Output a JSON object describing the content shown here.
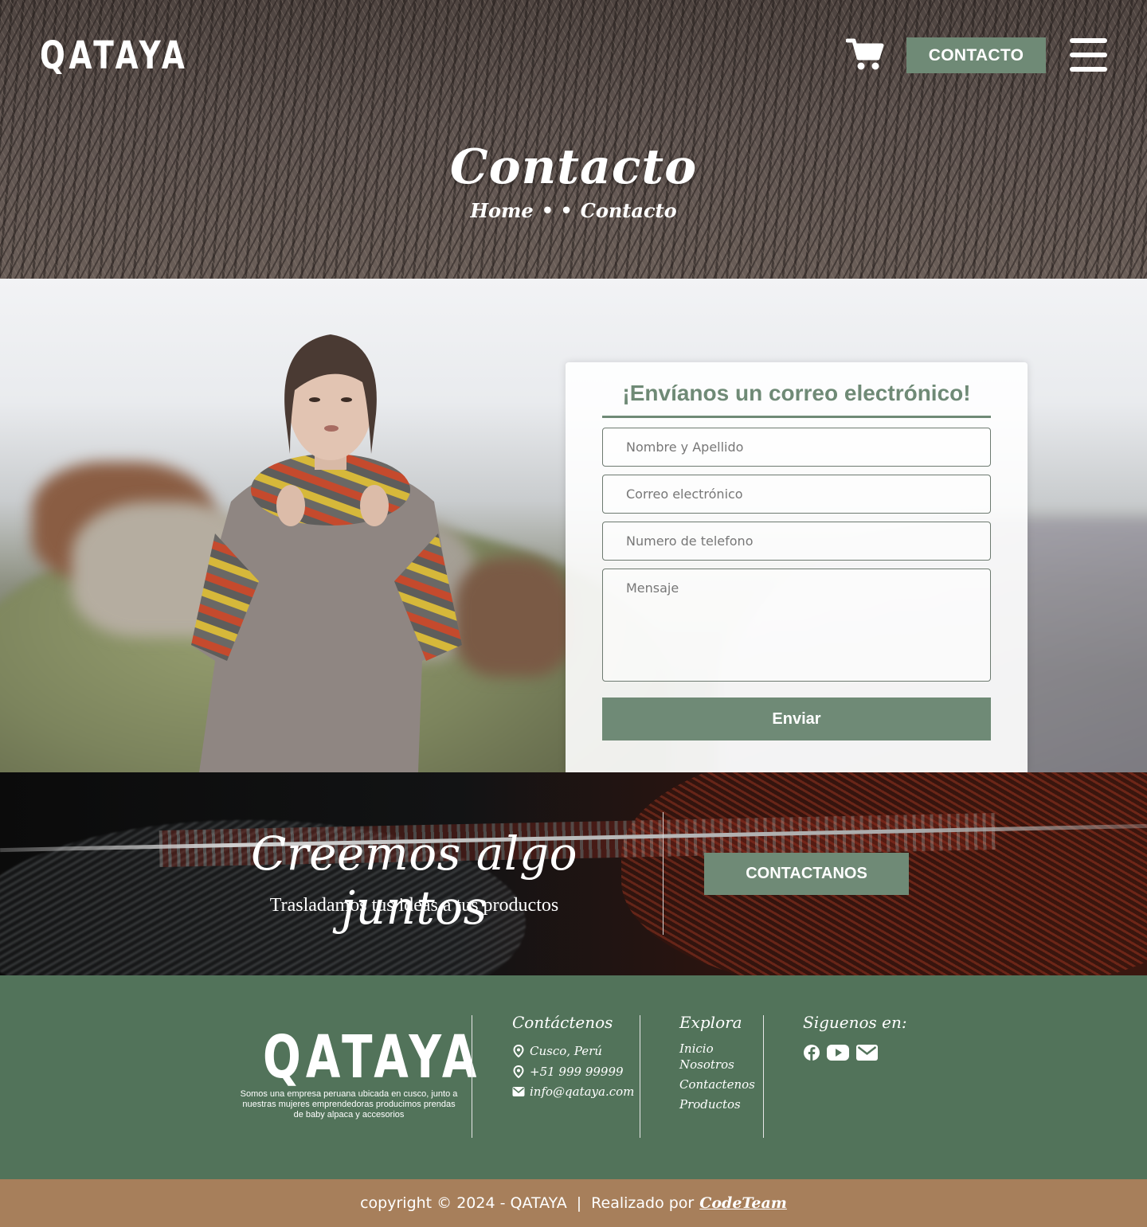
{
  "header": {
    "logo": "QATAYA",
    "cart_icon": "shopping-cart-icon",
    "contact_button": "CONTACTO",
    "menu_icon": "hamburger-menu-icon"
  },
  "hero": {
    "title": "Contacto",
    "breadcrumb": {
      "home": "Home",
      "separator": "• •",
      "current": "Contacto"
    }
  },
  "form": {
    "heading": "¡Envíanos un correo electrónico!",
    "name_placeholder": "Nombre y Apellido",
    "email_placeholder": "Correo electrónico",
    "phone_placeholder": "Numero de telefono",
    "message_placeholder": "Mensaje",
    "submit_label": "Enviar"
  },
  "cta": {
    "title": "Creemos algo juntos",
    "subtitle": "Trasladamos tus ideas a tus productos",
    "button": "CONTACTANOS"
  },
  "footer": {
    "logo": "QATAYA",
    "description": "Somos una empresa peruana ubicada en cusco, junto a nuestras mujeres emprendedoras producimos prendas de baby alpaca y accesorios",
    "contact": {
      "heading": "Contáctenos",
      "location": "Cusco, Perú",
      "phone": "+51 999 99999",
      "email": "info@qataya.com"
    },
    "explore": {
      "heading": "Explora",
      "links": [
        "Inicio",
        "Nosotros",
        "Contactenos",
        "Productos"
      ]
    },
    "social": {
      "heading": "Siguenos en:",
      "icons": [
        "facebook-icon",
        "youtube-icon",
        "mail-icon"
      ]
    }
  },
  "copyright": {
    "text": "copyright © 2024 - QATAYA",
    "separator": "|",
    "made_by": "Realizado por",
    "brand": "CodeTeam"
  },
  "colors": {
    "accent_green": "#6f8a76",
    "footer_green": "#52735a",
    "copyright_brown": "#a77f5b"
  }
}
